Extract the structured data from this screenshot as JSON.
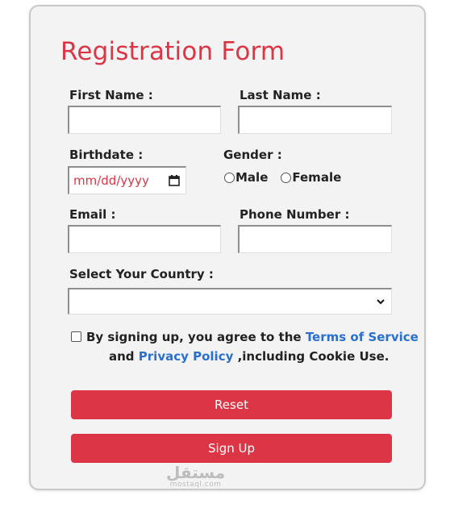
{
  "form": {
    "title": "Registration Form",
    "first_name_label": "First Name :",
    "last_name_label": "Last Name :",
    "birthdate_label": "Birthdate :",
    "birthdate_placeholder": "mm/dd/yyyy",
    "gender_label": "Gender :",
    "gender_options": [
      "Male",
      "Female"
    ],
    "email_label": "Email :",
    "phone_label": "Phone Number :",
    "country_label": "Select Your Country :",
    "terms_prefix": "By signing up, you agree to the",
    "terms_link": "Terms of Service",
    "terms_and": "and",
    "privacy_link": "Privacy Policy",
    "terms_suffix": ",including Cookie Use.",
    "reset_button": "Reset",
    "signup_button": "Sign Up"
  },
  "watermark": {
    "arabic": "مستقل",
    "latin": "mostaql.com"
  },
  "colors": {
    "accent": "#dc3545",
    "link": "#2a6fd0",
    "card_background": "#f3f3f3"
  }
}
